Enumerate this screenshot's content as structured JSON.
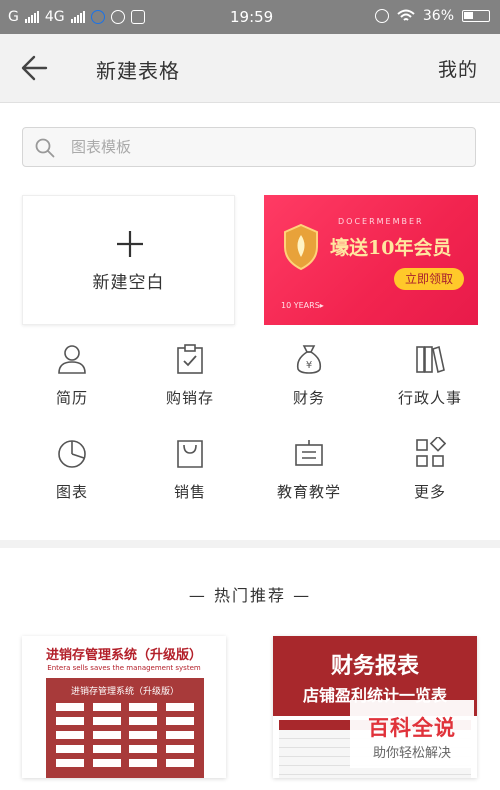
{
  "status_bar": {
    "carrier1": "G",
    "carrier2": "4G",
    "time": "19:59",
    "battery": "36%"
  },
  "app_bar": {
    "title": "新建表格",
    "right_action": "我的"
  },
  "search": {
    "placeholder": "图表模板"
  },
  "new_blank": {
    "label": "新建空白"
  },
  "banner": {
    "brand": "DOCERMEMBER",
    "headline": "壕送10年会员",
    "button": "立即领取",
    "footer": "10 YEARS▸"
  },
  "categories": [
    {
      "label": "简历",
      "icon": "person-icon"
    },
    {
      "label": "购销存",
      "icon": "clipboard-check-icon"
    },
    {
      "label": "财务",
      "icon": "money-bag-icon"
    },
    {
      "label": "行政人事",
      "icon": "books-icon"
    },
    {
      "label": "图表",
      "icon": "pie-chart-icon"
    },
    {
      "label": "销售",
      "icon": "shopping-bag-icon"
    },
    {
      "label": "教育教学",
      "icon": "easel-icon"
    },
    {
      "label": "更多",
      "icon": "more-grid-icon"
    }
  ],
  "hot": {
    "heading": "— 热门推荐 —",
    "templates": [
      {
        "title": "进销存管理系统（升级版）",
        "subtitle": "Entera sells saves the management system",
        "box_title": "进销存管理系统（升级版）"
      },
      {
        "title_line1": "财务报表",
        "title_line2": "店铺盈利统计一览表"
      }
    ]
  },
  "watermark": {
    "line1": "百科全说",
    "line2": "助你轻松解决"
  },
  "colors": {
    "banner": "#f2244f",
    "template_red": "#a8282c"
  }
}
